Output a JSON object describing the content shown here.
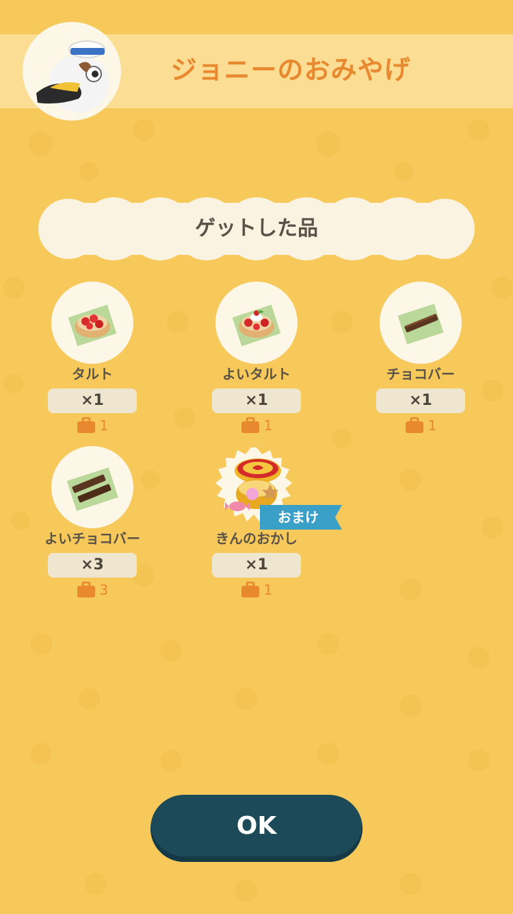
{
  "header": {
    "title": "ジョニーのおみやげ",
    "avatar_icon": "pelican-sailor-avatar-icon"
  },
  "section": {
    "title": "ゲットした品"
  },
  "items": [
    {
      "name": "タルト",
      "quantity": "×1",
      "bag_count": "1",
      "icon": "tart-icon",
      "bonus": false
    },
    {
      "name": "よいタルト",
      "quantity": "×1",
      "bag_count": "1",
      "icon": "good-tart-icon",
      "bonus": false
    },
    {
      "name": "チョコバー",
      "quantity": "×1",
      "bag_count": "1",
      "icon": "chocolate-bar-icon",
      "bonus": false
    },
    {
      "name": "よいチョコバー",
      "quantity": "×3",
      "bag_count": "3",
      "icon": "good-chocolate-bar-icon",
      "bonus": false
    },
    {
      "name": "きんのおかし",
      "quantity": "×1",
      "bag_count": "1",
      "icon": "gold-sweets-tin-icon",
      "bonus": true
    }
  ],
  "bonus_tag": {
    "label": "おまけ"
  },
  "ok_button": {
    "label": "OK"
  },
  "colors": {
    "background": "#f7c95a",
    "header_band": "#fbde94",
    "title_orange": "#e8892f",
    "button_dark_teal": "#1d4a58",
    "bonus_blue": "#3ba0c8"
  }
}
